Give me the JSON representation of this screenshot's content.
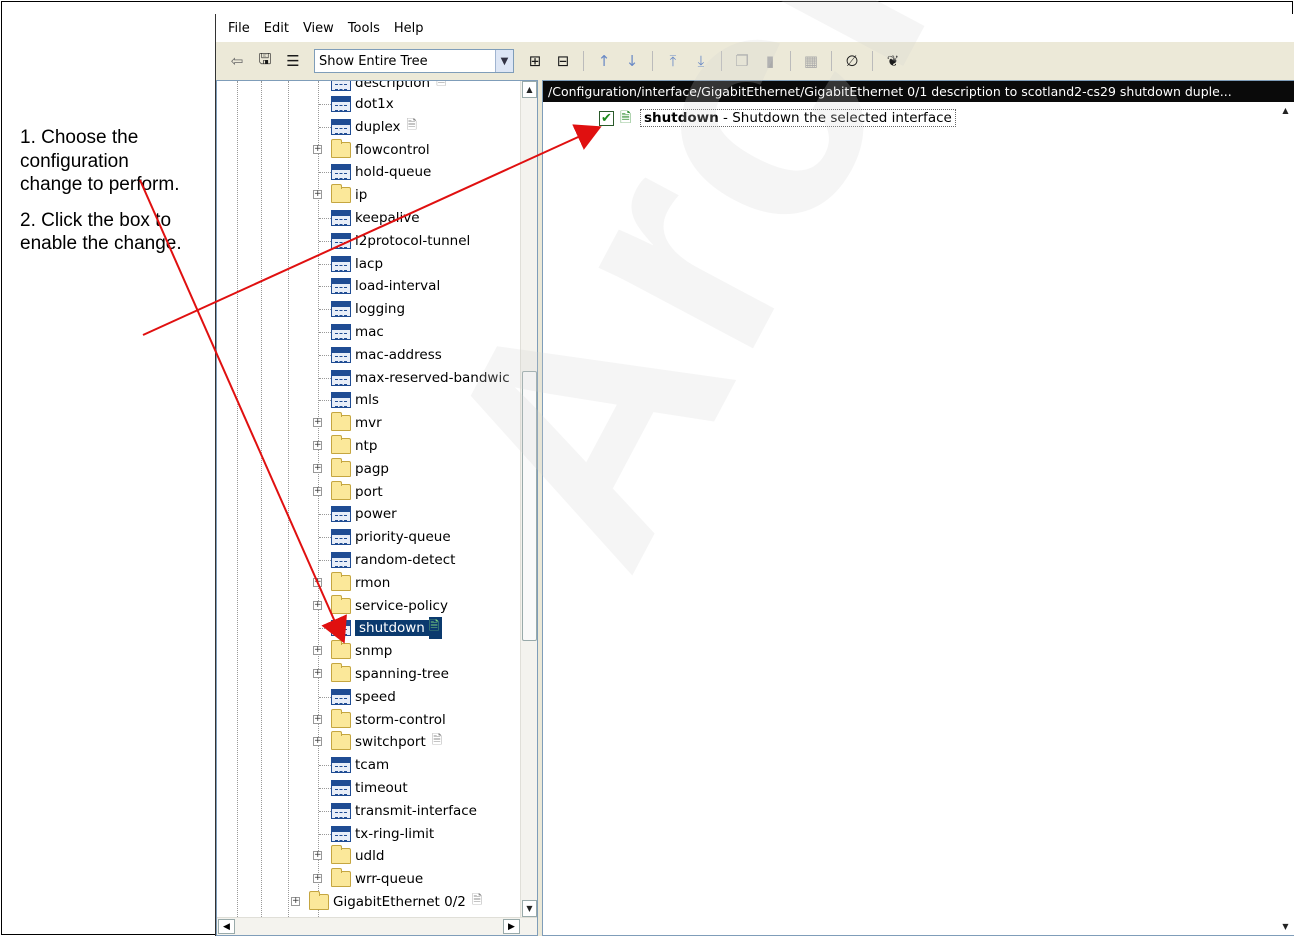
{
  "menu": [
    "File",
    "Edit",
    "View",
    "Tools",
    "Help"
  ],
  "toolbar": {
    "view_select": "Show Entire Tree"
  },
  "tree": {
    "partial_top": "description",
    "items": [
      {
        "label": "dot1x",
        "kind": "cfg",
        "doc": false
      },
      {
        "label": "duplex",
        "kind": "cfg",
        "doc": true
      },
      {
        "label": "flowcontrol",
        "kind": "folder",
        "doc": false
      },
      {
        "label": "hold-queue",
        "kind": "cfg",
        "doc": false
      },
      {
        "label": "ip",
        "kind": "folder",
        "doc": false
      },
      {
        "label": "keepalive",
        "kind": "cfg",
        "doc": false
      },
      {
        "label": "l2protocol-tunnel",
        "kind": "cfg",
        "doc": false
      },
      {
        "label": "lacp",
        "kind": "cfg",
        "doc": false
      },
      {
        "label": "load-interval",
        "kind": "cfg",
        "doc": false
      },
      {
        "label": "logging",
        "kind": "cfg",
        "doc": false
      },
      {
        "label": "mac",
        "kind": "cfg",
        "doc": false
      },
      {
        "label": "mac-address",
        "kind": "cfg",
        "doc": false
      },
      {
        "label": "max-reserved-bandwic",
        "kind": "cfg",
        "doc": false
      },
      {
        "label": "mls",
        "kind": "cfg",
        "doc": false
      },
      {
        "label": "mvr",
        "kind": "folder",
        "doc": false
      },
      {
        "label": "ntp",
        "kind": "folder",
        "doc": false
      },
      {
        "label": "pagp",
        "kind": "folder",
        "doc": false
      },
      {
        "label": "port",
        "kind": "folder",
        "doc": false
      },
      {
        "label": "power",
        "kind": "cfg",
        "doc": false
      },
      {
        "label": "priority-queue",
        "kind": "cfg",
        "doc": false
      },
      {
        "label": "random-detect",
        "kind": "cfg",
        "doc": false
      },
      {
        "label": "rmon",
        "kind": "folder",
        "doc": false
      },
      {
        "label": "service-policy",
        "kind": "folder",
        "doc": false
      },
      {
        "label": "shutdown",
        "kind": "cfg",
        "doc": true,
        "selected": true
      },
      {
        "label": "snmp",
        "kind": "folder",
        "doc": false
      },
      {
        "label": "spanning-tree",
        "kind": "folder",
        "doc": false
      },
      {
        "label": "speed",
        "kind": "cfg",
        "doc": false
      },
      {
        "label": "storm-control",
        "kind": "folder",
        "doc": false
      },
      {
        "label": "switchport",
        "kind": "folder",
        "doc": true
      },
      {
        "label": "tcam",
        "kind": "cfg",
        "doc": false
      },
      {
        "label": "timeout",
        "kind": "cfg",
        "doc": false
      },
      {
        "label": "transmit-interface",
        "kind": "cfg",
        "doc": false
      },
      {
        "label": "tx-ring-limit",
        "kind": "cfg",
        "doc": false
      },
      {
        "label": "udld",
        "kind": "folder",
        "doc": false
      },
      {
        "label": "wrr-queue",
        "kind": "folder",
        "doc": false
      }
    ],
    "last_item": {
      "label": "GigabitEthernet 0/2",
      "kind": "folder",
      "doc": true
    }
  },
  "content": {
    "path": "/Configuration/interface/GigabitEthernet/GigabitEthernet 0/1 description to scotland2-cs29 shutdown duple...",
    "item_name": "shutdown",
    "item_desc": " - Shutdown the selected interface",
    "checked": true
  },
  "annotations": {
    "step1": "1. Choose the configuration change to perform.",
    "step2": "2. Click the box to enable the change."
  },
  "watermark": "Archived",
  "colors": {
    "arrow": "#e01010",
    "selection": "#0b3a6e",
    "pathbar": "#0a0a0a"
  }
}
